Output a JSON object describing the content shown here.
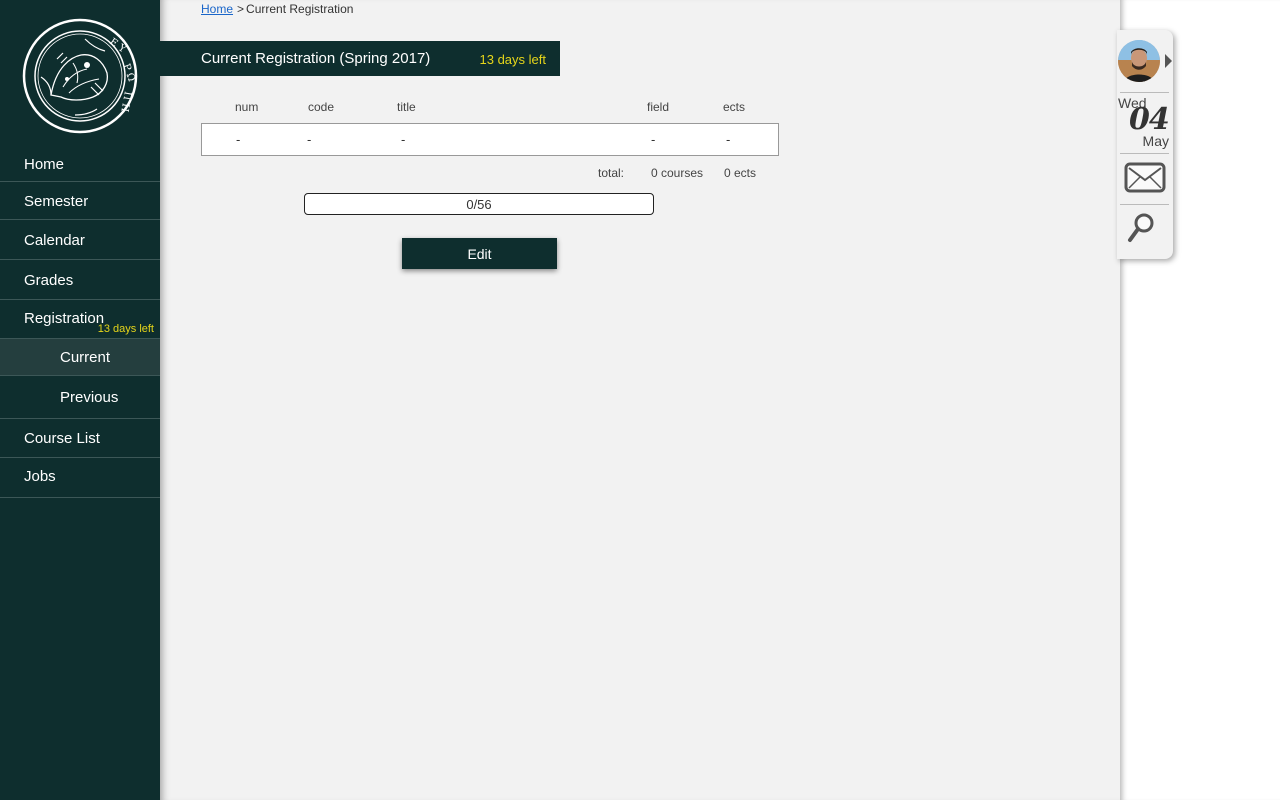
{
  "sidebar": {
    "logo_text": "ΕΥΡΩΠΗ",
    "items": [
      {
        "label": "Home"
      },
      {
        "label": "Semester"
      },
      {
        "label": "Calendar"
      },
      {
        "label": "Grades"
      },
      {
        "label": "Registration",
        "badge": "13 days left"
      },
      {
        "label": "Current",
        "active": true
      },
      {
        "label": "Previous"
      },
      {
        "label": "Course List"
      },
      {
        "label": "Jobs"
      }
    ]
  },
  "breadcrumb": {
    "home": "Home",
    "separator": ">",
    "current": "Current Registration"
  },
  "header": {
    "title": "Current Registration (Spring 2017)",
    "badge": "13 days left"
  },
  "table": {
    "columns": [
      "num",
      "code",
      "title",
      "field",
      "ects"
    ],
    "rows": [
      [
        "-",
        "-",
        "-",
        "-",
        "-"
      ]
    ]
  },
  "totals": {
    "label": "total:",
    "courses": "0 courses",
    "ects": "0 ects"
  },
  "progress": {
    "text": "0/56",
    "value": 0,
    "max": 56
  },
  "edit_button": "Edit",
  "widget": {
    "day_of_week": "Wed",
    "day": "04",
    "month": "May"
  },
  "colors": {
    "primary": "#0e2e2e",
    "accent": "#e5d51a",
    "link": "#1a66c9"
  },
  "icons": [
    "university-seal-logo",
    "avatar",
    "chevron-right-icon",
    "mail-icon",
    "search-icon"
  ]
}
